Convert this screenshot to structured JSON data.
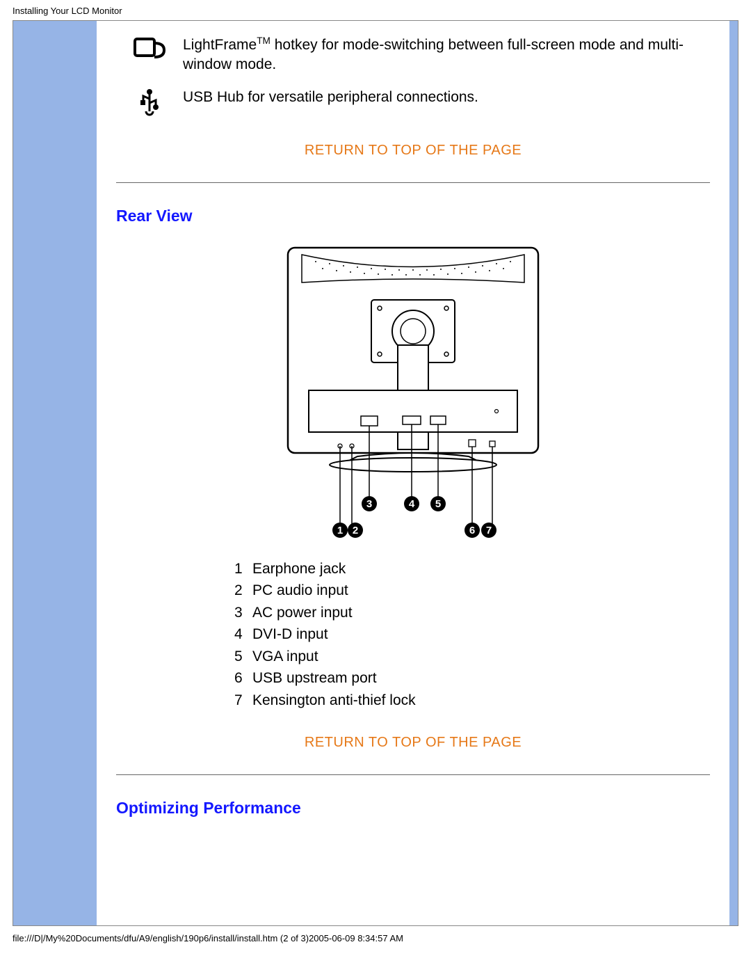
{
  "header": {
    "title": "Installing Your LCD Monitor"
  },
  "features": [
    {
      "icon": "lightframe-icon",
      "text_prefix": "LightFrame",
      "text_tm": "TM",
      "text_suffix": " hotkey for mode-switching between full-screen mode and multi-window mode."
    },
    {
      "icon": "usb-icon",
      "text_full": "USB Hub for versatile peripheral connections."
    }
  ],
  "return_link": "RETURN TO TOP OF THE PAGE",
  "sections": {
    "rear_view": {
      "title": "Rear View"
    },
    "optimizing": {
      "title": "Optimizing Performance"
    }
  },
  "ports": [
    {
      "num": "1",
      "label": "Earphone jack"
    },
    {
      "num": "2",
      "label": "PC audio input"
    },
    {
      "num": "3",
      "label": "AC power input"
    },
    {
      "num": "4",
      "label": "DVI-D input"
    },
    {
      "num": "5",
      "label": "VGA input"
    },
    {
      "num": "6",
      "label": "USB upstream port"
    },
    {
      "num": "7",
      "label": "Kensington anti-thief lock"
    }
  ],
  "callouts": [
    "1",
    "2",
    "3",
    "4",
    "5",
    "6",
    "7"
  ],
  "footer": {
    "path": "file:///D|/My%20Documents/dfu/A9/english/190p6/install/install.htm (2 of 3)2005-06-09 8:34:57 AM"
  }
}
